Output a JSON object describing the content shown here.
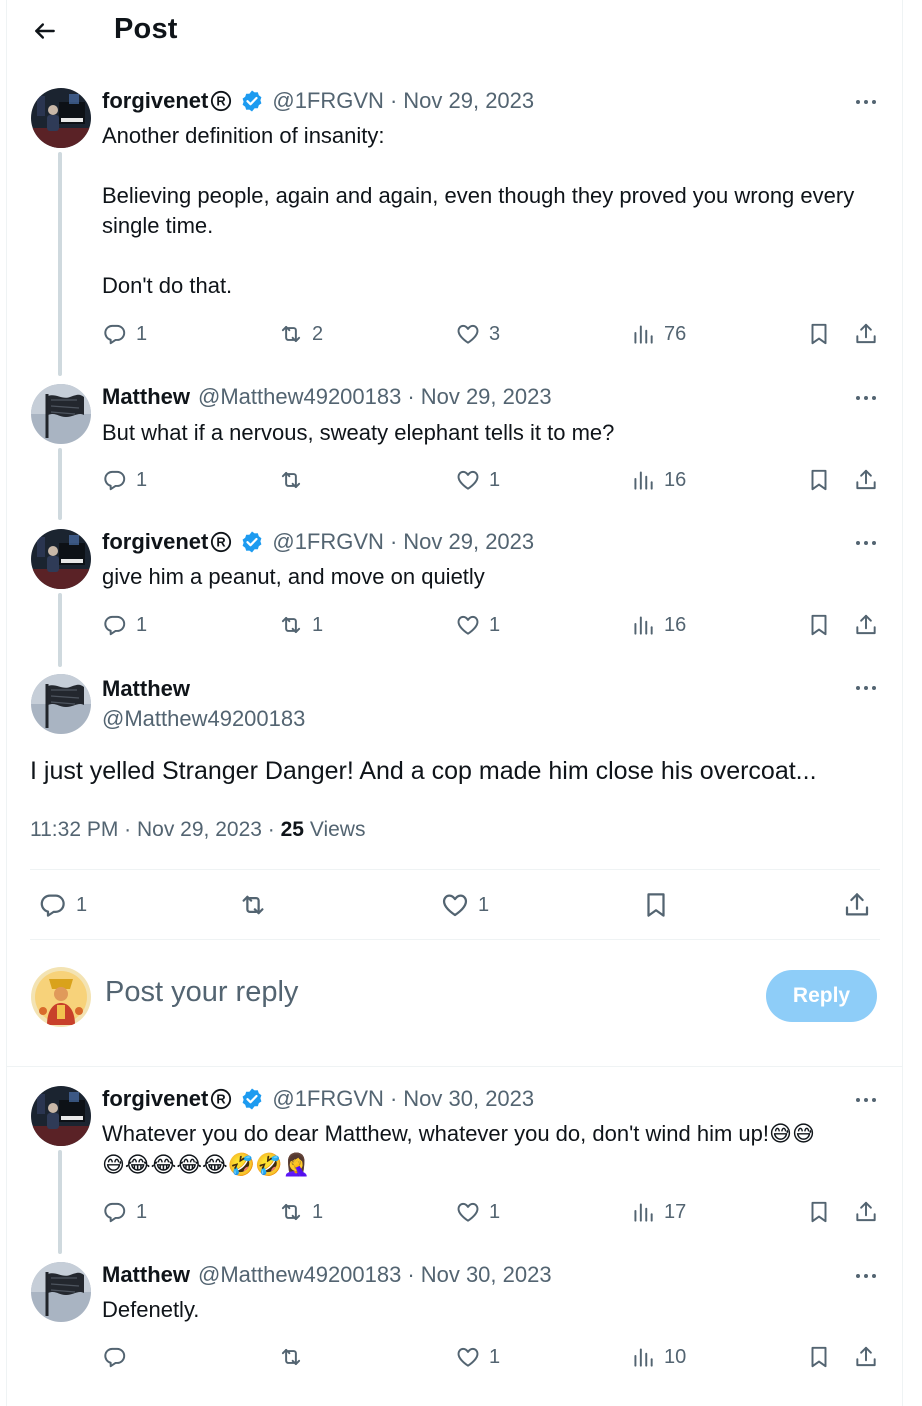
{
  "header": {
    "title": "Post"
  },
  "thread": [
    {
      "name": "forgivenet",
      "handle": "@1FRGVN",
      "date": "Nov 29, 2023",
      "text": "Another definition of insanity:\n\nBelieving people, again and again, even though they proved you wrong every single time.\n\nDon't do that.",
      "replies": "1",
      "reposts": "2",
      "likes": "3",
      "views": "76"
    },
    {
      "name": "Matthew",
      "handle": "@Matthew49200183",
      "date": "Nov 29, 2023",
      "text": "But what if a nervous, sweaty elephant tells it to me?",
      "replies": "1",
      "reposts": "",
      "likes": "1",
      "views": "16"
    },
    {
      "name": "forgivenet",
      "handle": "@1FRGVN",
      "date": "Nov 29, 2023",
      "text": "give him a peanut, and move on quietly",
      "replies": "1",
      "reposts": "1",
      "likes": "1",
      "views": "16"
    }
  ],
  "main_post": {
    "name": "Matthew",
    "handle": "@Matthew49200183",
    "text": "I just yelled Stranger Danger! And a cop made him close his overcoat...",
    "time": "11:32 PM",
    "date": "Nov 29, 2023",
    "views_count": "25",
    "views_label": "Views",
    "replies": "1",
    "reposts": "",
    "likes": "1"
  },
  "composer": {
    "placeholder": "Post your reply",
    "button": "Reply"
  },
  "replies": [
    {
      "name": "forgivenet",
      "handle": "@1FRGVN",
      "date": "Nov 30, 2023",
      "text": "Whatever you do dear Matthew, whatever you do, don't wind him up!😅😅",
      "emoji_line": "😅😂😂😂😂🤣🤣🤦‍♀️",
      "replies": "1",
      "reposts": "1",
      "likes": "1",
      "views": "17"
    },
    {
      "name": "Matthew",
      "handle": "@Matthew49200183",
      "date": "Nov 30, 2023",
      "text": "Defenetly.",
      "replies": "",
      "reposts": "",
      "likes": "1",
      "views": "10"
    }
  ],
  "colors": {
    "accent": "#1d9bf0",
    "muted": "#536471",
    "reply_button": "#8ecdf8"
  },
  "icons": [
    "back-arrow-icon",
    "verified-badge-icon",
    "registered-icon",
    "more-icon",
    "reply-icon",
    "repost-icon",
    "like-icon",
    "views-icon",
    "bookmark-icon",
    "share-icon"
  ]
}
